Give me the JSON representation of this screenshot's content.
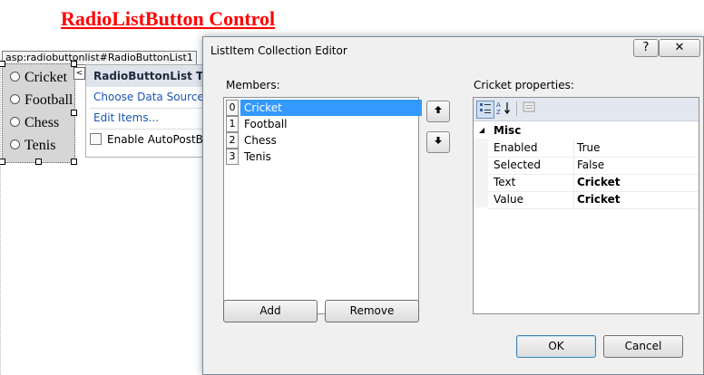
{
  "page_heading": "RadioListButton Control",
  "control_tag": "asp:radiobuttonlist#RadioButtonList1",
  "radio_items": [
    "Cricket",
    "Football",
    "Chess",
    "Tenis"
  ],
  "tasks_panel": {
    "title": "RadioButtonList Tasks",
    "choose_data_source": "Choose Data Source...",
    "edit_items": "Edit Items...",
    "enable_autopostback": "Enable AutoPostBack"
  },
  "dialog": {
    "title": "ListItem Collection Editor",
    "help_glyph": "?",
    "close_glyph": "✕",
    "members_label": "Members:",
    "members": [
      {
        "index": "0",
        "text": "Cricket",
        "selected": true
      },
      {
        "index": "1",
        "text": "Football",
        "selected": false
      },
      {
        "index": "2",
        "text": "Chess",
        "selected": false
      },
      {
        "index": "3",
        "text": "Tenis",
        "selected": false
      }
    ],
    "add_label": "Add",
    "remove_label": "Remove",
    "properties_label": "Cricket properties:",
    "category": "Misc",
    "properties": [
      {
        "name": "Enabled",
        "value": "True",
        "bold": false
      },
      {
        "name": "Selected",
        "value": "False",
        "bold": false
      },
      {
        "name": "Text",
        "value": "Cricket",
        "bold": true
      },
      {
        "name": "Value",
        "value": "Cricket",
        "bold": true
      }
    ],
    "ok_label": "OK",
    "cancel_label": "Cancel"
  },
  "colors": {
    "heading": "#ff0000",
    "selection": "#3399ff",
    "link": "#1b56b0"
  }
}
